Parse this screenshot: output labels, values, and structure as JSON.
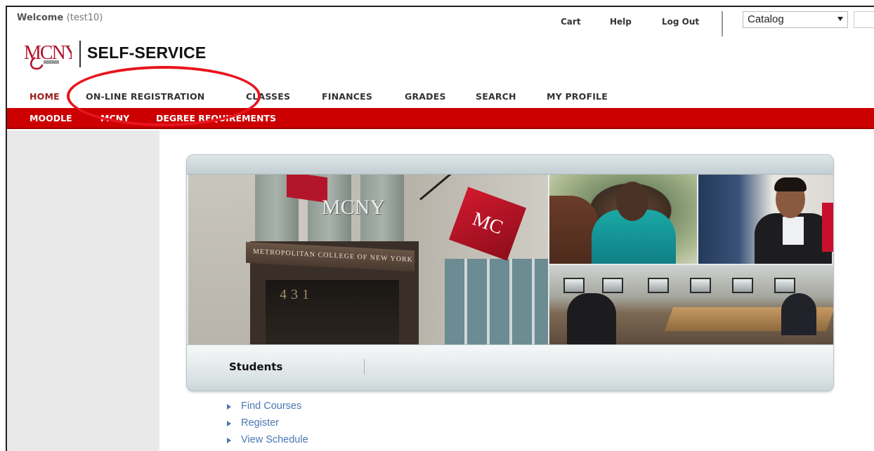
{
  "header": {
    "welcome_label": "Welcome",
    "welcome_user": "(test10)",
    "cart": "Cart",
    "help": "Help",
    "logout": "Log Out",
    "catalog_select": "Catalog",
    "brand_title": "SELF-SERVICE",
    "logo_text": "MCNY"
  },
  "nav_primary": [
    {
      "label": "HOME",
      "active": true
    },
    {
      "label": "ON-LINE REGISTRATION"
    },
    {
      "label": "CLASSES"
    },
    {
      "label": "FINANCES"
    },
    {
      "label": "GRADES"
    },
    {
      "label": "SEARCH"
    },
    {
      "label": "MY PROFILE"
    }
  ],
  "nav_secondary": [
    {
      "label": "MOODLE"
    },
    {
      "label": "MCNY"
    },
    {
      "label": "DEGREE REQUIREMENTS"
    }
  ],
  "banner": {
    "awning_text": "METROPOLITAN COLLEGE OF NEW YORK",
    "door_number": "431",
    "sign_text": "MCNY",
    "flag_text": "MC"
  },
  "panel": {
    "title": "Students"
  },
  "links": [
    {
      "label": "Find Courses"
    },
    {
      "label": "Register"
    },
    {
      "label": "View Schedule"
    }
  ],
  "colors": {
    "brand_red": "#cc0000",
    "active_nav": "#9b1c1c",
    "link_blue": "#4a77b4",
    "annotation": "#e8141e"
  }
}
